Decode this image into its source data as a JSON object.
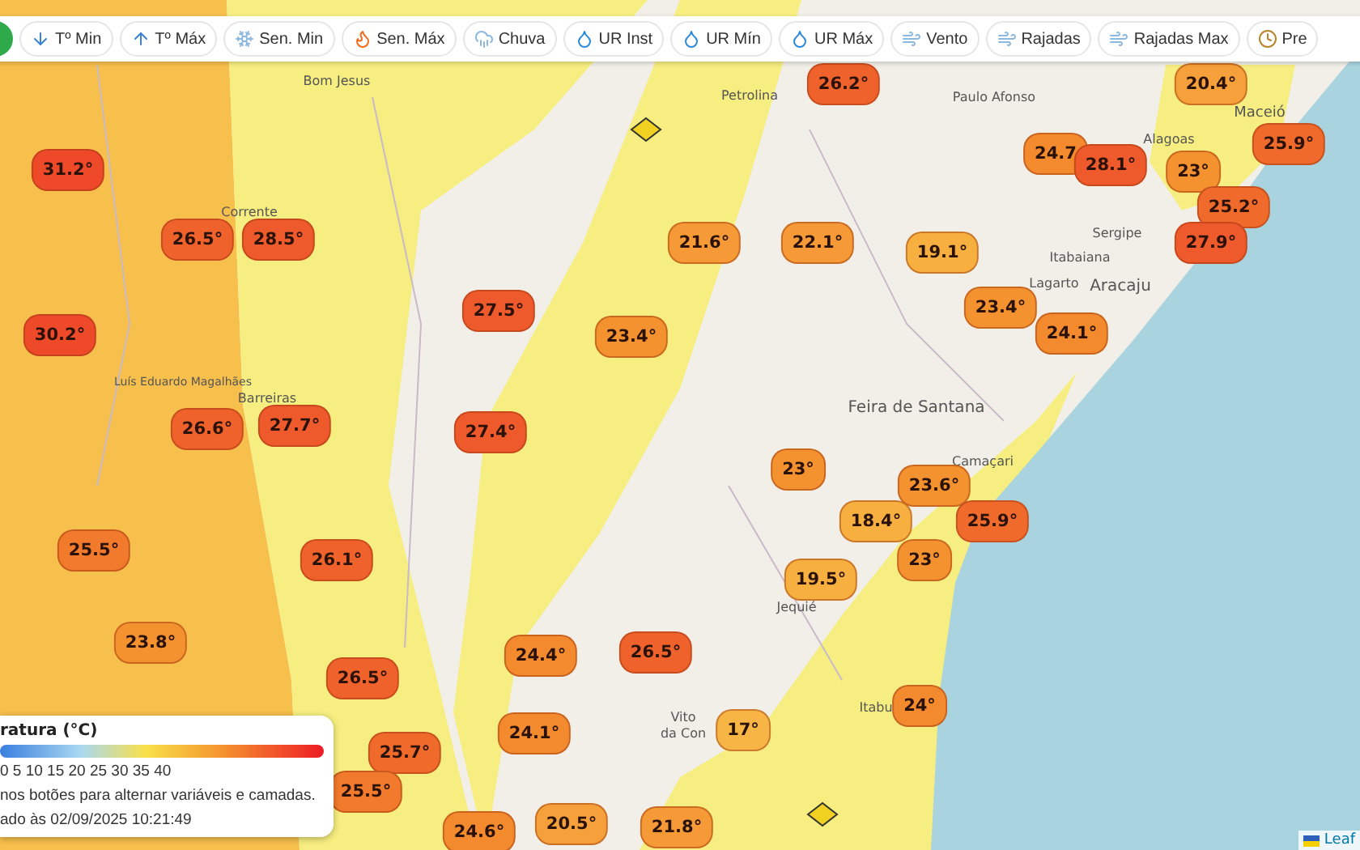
{
  "toolbar": {
    "buttons": [
      {
        "label": "Tº Min",
        "kind": "down"
      },
      {
        "label": "Tº Máx",
        "kind": "up"
      },
      {
        "label": "Sen. Min",
        "kind": "snow"
      },
      {
        "label": "Sen. Máx",
        "kind": "fire"
      },
      {
        "label": "Chuva",
        "kind": "rain"
      },
      {
        "label": "UR Inst",
        "kind": "drop"
      },
      {
        "label": "UR Mín",
        "kind": "drop"
      },
      {
        "label": "UR Máx",
        "kind": "drop"
      },
      {
        "label": "Vento",
        "kind": "wind"
      },
      {
        "label": "Rajadas",
        "kind": "wind"
      },
      {
        "label": "Rajadas Max",
        "kind": "wind"
      },
      {
        "label": "Pre",
        "kind": "clock"
      }
    ]
  },
  "map": {
    "places": [
      "Bom Jesus",
      "Petrolina",
      "Paulo Afonso",
      "Maceió",
      "Alagoas",
      "Corrente",
      "Sergipe",
      "Itabaiana",
      "Lagarto",
      "Aracaju",
      "Luís Eduardo Magalhães",
      "Barreiras",
      "Feira de Santana",
      "Camaçari",
      "Jequié",
      "Itabu",
      "Vito",
      "da Con"
    ],
    "markers": [
      {
        "temp": "31.2°",
        "color": "#ee4a2a"
      },
      {
        "temp": "26.5°",
        "color": "#f0622c"
      },
      {
        "temp": "28.5°",
        "color": "#ee5a2b"
      },
      {
        "temp": "30.2°",
        "color": "#ee4a2a"
      },
      {
        "temp": "26.6°",
        "color": "#f0622c"
      },
      {
        "temp": "27.7°",
        "color": "#ee5a2b"
      },
      {
        "temp": "25.5°",
        "color": "#f27a2d"
      },
      {
        "temp": "26.1°",
        "color": "#f0622c"
      },
      {
        "temp": "23.8°",
        "color": "#f59230"
      },
      {
        "temp": "26.5°",
        "color": "#f0622c"
      },
      {
        "temp": "25.7°",
        "color": "#f06a2c"
      },
      {
        "temp": "25.5°",
        "color": "#f27a2d"
      },
      {
        "temp": "24.6°",
        "color": "#f38a2e"
      },
      {
        "temp": "20.5°",
        "color": "#f5a03a"
      },
      {
        "temp": "21.8°",
        "color": "#f59a36"
      },
      {
        "temp": "24.1°",
        "color": "#f38a2e"
      },
      {
        "temp": "24.4°",
        "color": "#f38a2e"
      },
      {
        "temp": "26.5°",
        "color": "#f0622c"
      },
      {
        "temp": "17°",
        "color": "#f7b545"
      },
      {
        "temp": "27.5°",
        "color": "#ee5a2b"
      },
      {
        "temp": "27.4°",
        "color": "#ee5a2b"
      },
      {
        "temp": "23.4°",
        "color": "#f59230"
      },
      {
        "temp": "21.6°",
        "color": "#f59a36"
      },
      {
        "temp": "22.1°",
        "color": "#f59a36"
      },
      {
        "temp": "26.2°",
        "color": "#f0622c"
      },
      {
        "temp": "20.4°",
        "color": "#f5a03a"
      },
      {
        "temp": "19.1°",
        "color": "#f7b040"
      },
      {
        "temp": "23.4°",
        "color": "#f59230"
      },
      {
        "temp": "24.1°",
        "color": "#f38a2e"
      },
      {
        "temp": "24.7",
        "color": "#f38a2e"
      },
      {
        "temp": "28.1°",
        "color": "#ee5a2b"
      },
      {
        "temp": "23°",
        "color": "#f59230"
      },
      {
        "temp": "25.9°",
        "color": "#f06a2c"
      },
      {
        "temp": "25.2°",
        "color": "#f06a2c"
      },
      {
        "temp": "27.9°",
        "color": "#ee5a2b"
      },
      {
        "temp": "23°",
        "color": "#f59230"
      },
      {
        "temp": "18.4°",
        "color": "#f7b040"
      },
      {
        "temp": "23.6°",
        "color": "#f59230"
      },
      {
        "temp": "25.9°",
        "color": "#f06a2c"
      },
      {
        "temp": "23°",
        "color": "#f59230"
      },
      {
        "temp": "19.5°",
        "color": "#f7b040"
      },
      {
        "temp": "24°",
        "color": "#f38a2e"
      }
    ]
  },
  "legend": {
    "title": "ratura (°C)",
    "scale": "0 5 10 15 20 25 30 35 40",
    "hint": "nos botões para alternar variáveis e camadas.",
    "updated": "ado às 02/09/2025 10:21:49"
  },
  "attribution": "Leaf"
}
